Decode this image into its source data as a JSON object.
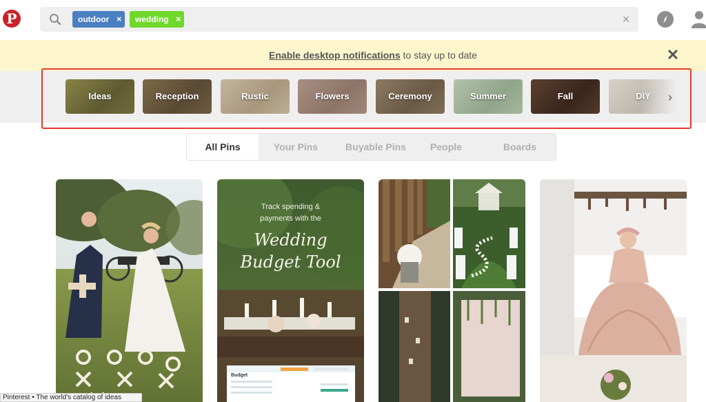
{
  "header": {
    "logo_letter": "P",
    "search": {
      "chips": [
        {
          "label": "outdoor",
          "color": "#4a7fc1"
        },
        {
          "label": "wedding",
          "color": "#6fd82b"
        }
      ],
      "chip_remove_glyph": "×",
      "clear_glyph": "×",
      "icons": [
        "search-icon",
        "close-icon"
      ]
    },
    "nav_icons": [
      "compass-icon",
      "profile-icon"
    ]
  },
  "notification": {
    "link_text": "Enable desktop notifications",
    "rest_text": " to stay up to date",
    "close_glyph": "✕",
    "background": "#fdf6cd"
  },
  "guides": {
    "items": [
      {
        "label": "Ideas",
        "color": "#6e6a3b"
      },
      {
        "label": "Reception",
        "color": "#6b5a3f"
      },
      {
        "label": "Rustic",
        "color": "#b3a48c"
      },
      {
        "label": "Flowers",
        "color": "#9a8275"
      },
      {
        "label": "Ceremony",
        "color": "#7a6a55"
      },
      {
        "label": "Summer",
        "color": "#a0b39a"
      },
      {
        "label": "Fall",
        "color": "#4a3428"
      },
      {
        "label": "DIY",
        "color": "#c4bfb6"
      }
    ],
    "next_glyph": "›",
    "highlight_color": "#e03a2c"
  },
  "tabs": [
    {
      "label": "All Pins",
      "active": true
    },
    {
      "label": "Your Pins",
      "active": false
    },
    {
      "label": "Buyable Pins",
      "active": false
    },
    {
      "label": "People",
      "active": false
    },
    {
      "label": "Boards",
      "active": false
    }
  ],
  "pins": [
    {
      "kind": "photo",
      "description": "couple playing giant tic-tac-toe on lawn"
    },
    {
      "kind": "infographic",
      "text_line1": "Track spending &",
      "text_line2": "payments with the",
      "script_line1": "Wedding",
      "script_line2": "Budget Tool",
      "budget_label": "Budget"
    },
    {
      "kind": "collage",
      "description": "outdoor ceremony aisle collage"
    },
    {
      "kind": "photo",
      "description": "bride in blush gown seated indoors"
    }
  ],
  "statusbar": {
    "text": "Pinterest • The world's catalog of ideas"
  }
}
